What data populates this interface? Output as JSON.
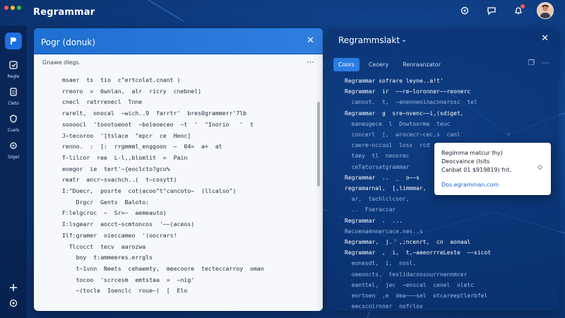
{
  "app": {
    "title": "Regrammar"
  },
  "colors": {
    "accent": "#2a7ce2",
    "dot_red": "#ff5f57",
    "dot_yellow": "#febc2e",
    "dot_green": "#28c840",
    "notif": "#ff5a4e"
  },
  "topbar": {
    "icons": [
      "settings-icon",
      "chat-icon",
      "bell-icon"
    ]
  },
  "rail": {
    "items": [
      {
        "label": "Regle",
        "icon": "edit-icon"
      },
      {
        "label": "Cleto",
        "icon": "doc-icon"
      },
      {
        "label": "Cuels",
        "icon": "shield-icon"
      },
      {
        "label": "Siigel",
        "icon": "gear-icon"
      }
    ],
    "bottom_icons": [
      "plus-icon",
      "settings-icon"
    ]
  },
  "editor": {
    "tab_title": "Pogr (donuk)",
    "breadcrumb": "Gnawe dlegs.",
    "lines": [
      {
        "t": "  msaer  ts  tio  c\"ertcolat.cnant )"
      },
      {
        "t": "  rreoro  =  6wnlan,  alr  ricry  cnebnel)"
      },
      {
        "t": "  cnecl  ratrrenecl  Tnne"
      },
      {
        "t": "  rarelt,  onocal  ~wich..9  farrtr'  bres0grammerr'7lb"
      },
      {
        "t": "  soooocl  'toootoeoot  ~boleoeceo  ~t  '  \"Inorio   '  t"
      },
      {
        "t": "  J~tecoroo  '[tslace  \"epcr  ce  Heoc]"
      },
      {
        "t": "  renno.  :  [:  rrgmmml_enggoon  ~  04=  a+  at"
      },
      {
        "t": "  T-lilcor  ree  L-l,,blomlit  =  Pain"
      },
      {
        "t": "  eoegor  ie  tert'~{eoclcto?gco%"
      },
      {
        "t": "  reatr  ancr~svachch..(  t~cosytt)"
      },
      {
        "t": "  I:\"Doecr,  posrte  cot(acoo\"t\"cancoto~  (llcalso\")"
      },
      {
        "t": "      Drgcr  Gents  Baloto:"
      },
      {
        "t": "  F:lelgcroc  ~  Sr=~  aemeauto)"
      },
      {
        "t": "  I:lsgearr  aocct~scmtoncos  '~~(aceos)"
      },
      {
        "t": "  Ilf:gramer  oieccameo  '(oocrars!"
      },
      {
        "t": "    Tlcocct  tecv  aarozwa"
      },
      {
        "t": "      boy  t:ammeeres.errgls"
      },
      {
        "t": "      t~1vnn  Neets  cehaemty,  meecoore  tecteccarroy  oman"
      },
      {
        "t": "      tocoo  'scrcesm  emtstaa  =  ~nig'"
      },
      {
        "t": "      ~(tocle  Ioenclc  roue~(  [  Elo"
      }
    ]
  },
  "rpanel": {
    "title": "Regrammslakt",
    "tabs": [
      "Coors",
      "Ceoery",
      "Renraanzator"
    ],
    "lines": [
      {
        "t": "Regrammar sofrare leyne..a!t'",
        "c": "kw"
      },
      {
        "t": "Regrammar  ir  ~~re~loronner~~reonerc",
        "c": "kw"
      },
      {
        "t": "  cannot,  t,  ~anenneninacnnerosc  tel",
        "c": "dim"
      },
      {
        "t": "Regrammar  g  sre~nvenc~~i,(sdiget,",
        "c": "kw"
      },
      {
        "t": "  eaneugece  l  Dowtoorme  teuc",
        "c": "dim"
      },
      {
        "t": "  concerl  [,  wrocecr~cec,s  canl",
        "c": "dim"
      },
      {
        "t": "  caere~nccuul  loss  rcd  ,lec",
        "c": "dim"
      },
      {
        "t": "  taey  tl  neonrec",
        "c": "dim"
      },
      {
        "t": "  ceTatorsatgrammar",
        "c": "dim"
      },
      {
        "t": "Regrammar  ..  _  o~~s",
        "c": "kw"
      },
      {
        "t": "regramarnal,  [,limmmar,",
        "c": "kw"
      },
      {
        "t": "  ar,  tachlclcoor,",
        "c": "dim"
      },
      {
        "t": "  ..  Fseraccar",
        "c": "dim"
      },
      {
        "t": "Regrammar  .  ...",
        "c": "kw"
      },
      {
        "t": "Recoenaennercace.nes..s",
        "c": "dim"
      },
      {
        "t": "Regrammar,  j.  ,;ncenrt,  cn  aonaal",
        "c": "kw"
      },
      {
        "t": "Regrammar  ,  i,  t,~aeeorrreLeste  ~~sicot",
        "c": "kw"
      },
      {
        "t": "  eonesdt,  i,  nosl,",
        "c": "dim"
      },
      {
        "t": "  oeeoncts,  teslidacoosourrnennmcer",
        "c": "dim"
      },
      {
        "t": "  eanttel,  jec  ~enscal  cenel  oletc",
        "c": "dim"
      },
      {
        "t": "  eortoen  ,e  dea~~~sel  otcareeptlerbfel",
        "c": "dim"
      },
      {
        "t": "  eecscnirnner  nofrlos",
        "c": "dim"
      }
    ]
  },
  "popup": {
    "line1": "Regimma  matcur  lhy)",
    "line2": "Deocvaince  (Isits",
    "line3": "Canbat  01  $919819)  fnt.",
    "link": "Dos.egramman.com"
  }
}
